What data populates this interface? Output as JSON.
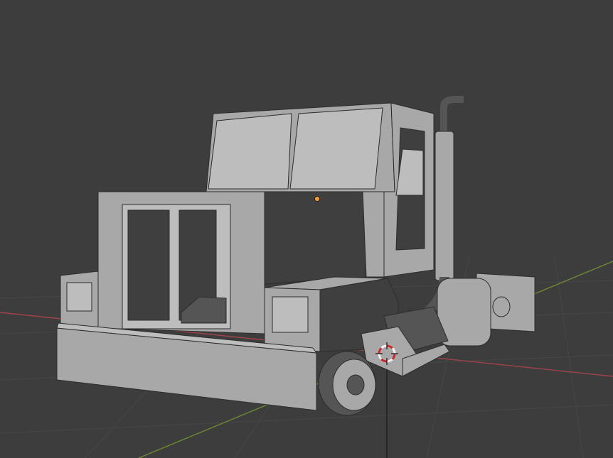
{
  "viewport": {
    "background": "#3d3d3d",
    "grid_color": "#474747",
    "x_axis_color": "#a0434b",
    "y_axis_color": "#6d8a2f"
  },
  "model": {
    "base_color": "#a8a8a8",
    "shadow_color": "#555555",
    "dark_color": "#3f3f3f",
    "window_color": "#bdbdbd",
    "edge_color": "#2c2c2c",
    "origin_dot_color": "#f39a2a"
  },
  "cursor": {
    "icon": "3d-cursor-icon",
    "ring_red": "#d02626",
    "ring_white": "#f2f2f2"
  }
}
